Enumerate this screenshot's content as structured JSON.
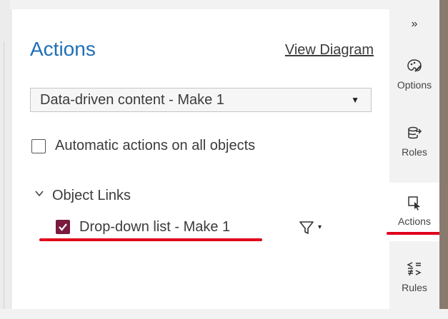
{
  "panel": {
    "title": "Actions",
    "view_diagram_label": "View Diagram",
    "source_select": {
      "value": "Data-driven content - Make 1",
      "caret": "▼"
    },
    "auto_actions": {
      "label": "Automatic actions on all objects",
      "checked": false
    },
    "object_links": {
      "section_label": "Object Links",
      "expanded": true,
      "items": [
        {
          "label": "Drop-down list - Make 1",
          "checked": true,
          "filter_caret": "▾"
        }
      ]
    }
  },
  "rail": {
    "collapse_glyph": "»",
    "items": [
      {
        "label": "Options",
        "icon": "palette-icon",
        "active": false
      },
      {
        "label": "Roles",
        "icon": "database-arrow-icon",
        "active": false
      },
      {
        "label": "Actions",
        "icon": "pointer-select-icon",
        "active": true
      },
      {
        "label": "Rules",
        "icon": "comparison-icon",
        "active": false
      }
    ]
  },
  "colors": {
    "accent": "#1f6fb4",
    "checkbox_checked": "#7a1a3f",
    "annotation": "#e0001b"
  }
}
